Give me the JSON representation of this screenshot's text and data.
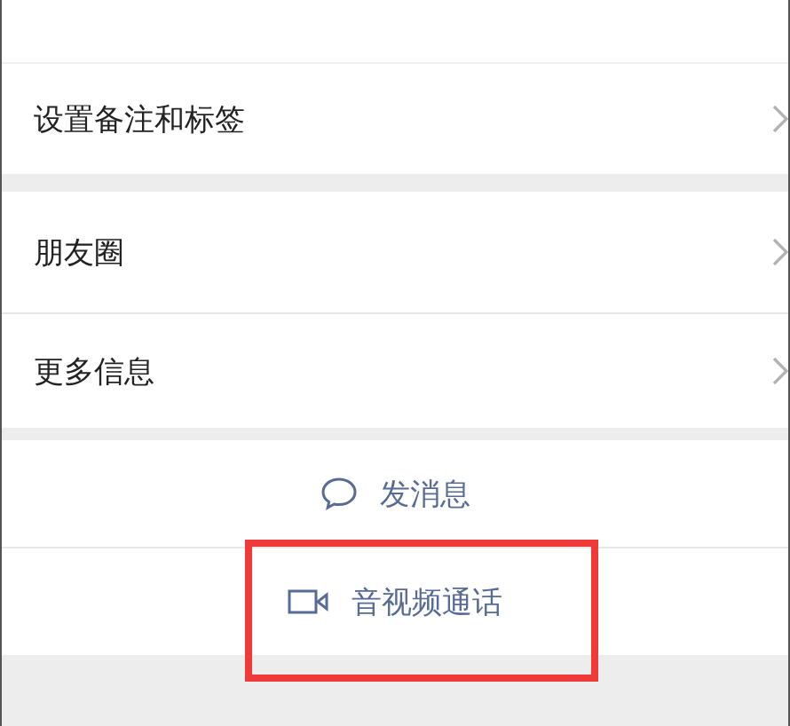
{
  "menu_groups": [
    [
      {
        "label": "设置备注和标签"
      }
    ],
    [
      {
        "label": "朋友圈"
      },
      {
        "label": "更多信息"
      }
    ]
  ],
  "actions": [
    {
      "kind": "message",
      "label": "发消息",
      "highlighted": false
    },
    {
      "kind": "video_call",
      "label": "音视频通话",
      "highlighted": true
    }
  ]
}
